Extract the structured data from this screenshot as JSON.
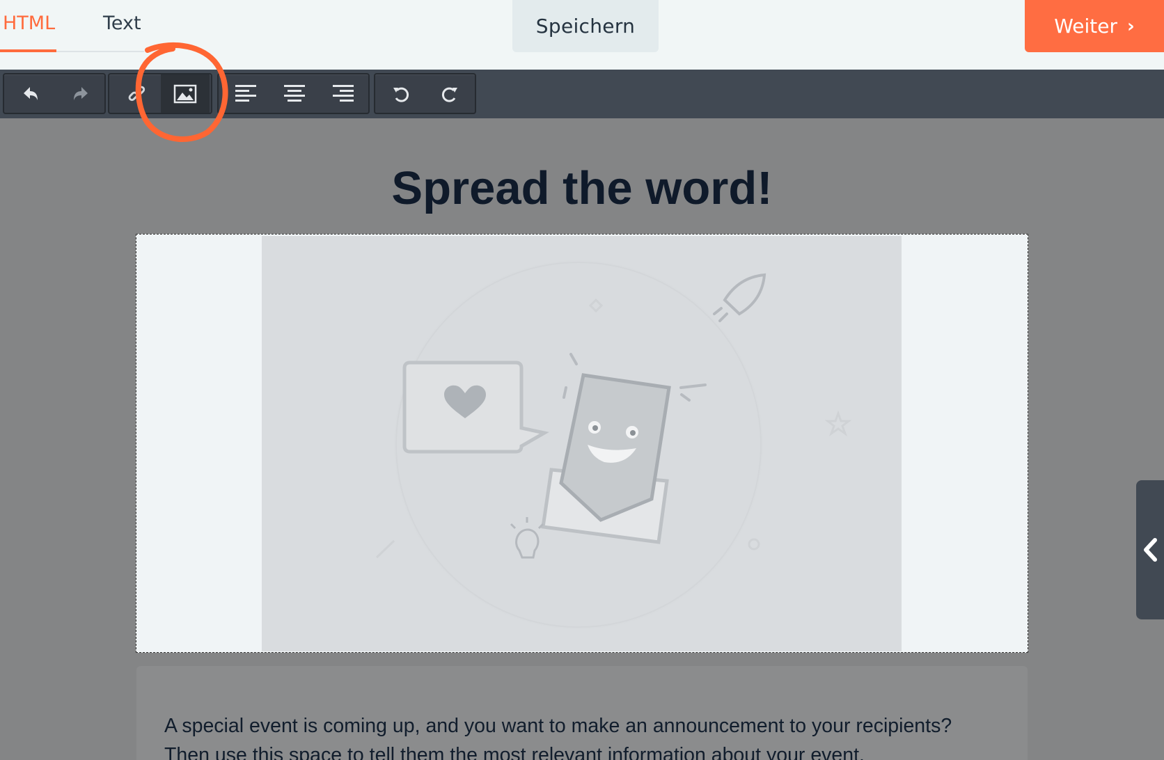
{
  "tabs": [
    {
      "label": "HTML",
      "active": true
    },
    {
      "label": "Text",
      "active": false
    }
  ],
  "actions": {
    "save_label": "Speichern",
    "next_label": "Weiter"
  },
  "toolbar": {
    "icons": [
      "undo-arrow-icon",
      "redo-arrow-icon",
      "link-icon",
      "image-icon",
      "align-left-icon",
      "align-center-icon",
      "align-right-icon",
      "undo-icon",
      "redo-icon"
    ]
  },
  "content": {
    "headline": "Spread the word!",
    "body_line_1": "A special event is coming up, and you want to make an announcement to your recipients?",
    "body_line_2": "Then use this space to tell them the most relevant information about your event."
  },
  "colors": {
    "accent": "#ff6d42",
    "toolbar": "#414953",
    "canvas": "#848586",
    "annotation": "#ff6633"
  }
}
